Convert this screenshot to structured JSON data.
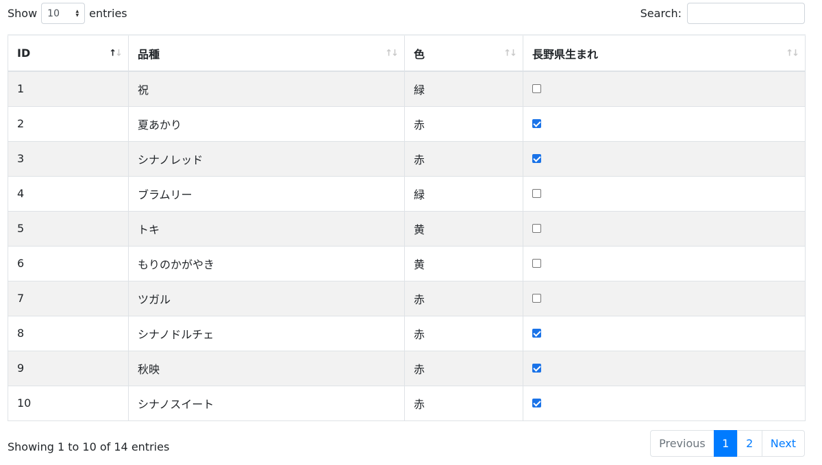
{
  "length_control": {
    "show_label": "Show",
    "selected": "10",
    "entries_label": "entries"
  },
  "search": {
    "label": "Search:",
    "value": "",
    "placeholder": ""
  },
  "table": {
    "columns": [
      {
        "label": "ID",
        "sort": "asc"
      },
      {
        "label": "品種",
        "sort": "none"
      },
      {
        "label": "色",
        "sort": "none"
      },
      {
        "label": "長野県生まれ",
        "sort": "none"
      }
    ],
    "rows": [
      {
        "id": "1",
        "variety": "祝",
        "color": "緑",
        "nagano": false
      },
      {
        "id": "2",
        "variety": "夏あかり",
        "color": "赤",
        "nagano": true
      },
      {
        "id": "3",
        "variety": "シナノレッド",
        "color": "赤",
        "nagano": true
      },
      {
        "id": "4",
        "variety": "ブラムリー",
        "color": "緑",
        "nagano": false
      },
      {
        "id": "5",
        "variety": "トキ",
        "color": "黄",
        "nagano": false
      },
      {
        "id": "6",
        "variety": "もりのかがやき",
        "color": "黄",
        "nagano": false
      },
      {
        "id": "7",
        "variety": "ツガル",
        "color": "赤",
        "nagano": false
      },
      {
        "id": "8",
        "variety": "シナノドルチェ",
        "color": "赤",
        "nagano": true
      },
      {
        "id": "9",
        "variety": "秋映",
        "color": "赤",
        "nagano": true
      },
      {
        "id": "10",
        "variety": "シナノスイート",
        "color": "赤",
        "nagano": true
      }
    ]
  },
  "footer": {
    "info": "Showing 1 to 10 of 14 entries",
    "pagination": {
      "previous": "Previous",
      "pages": [
        "1",
        "2"
      ],
      "current": "1",
      "next": "Next"
    }
  },
  "colors": {
    "accent": "#007bff",
    "checkbox_checked": "#1a73e8",
    "stripe": "#f2f2f2",
    "border": "#dee2e6"
  }
}
